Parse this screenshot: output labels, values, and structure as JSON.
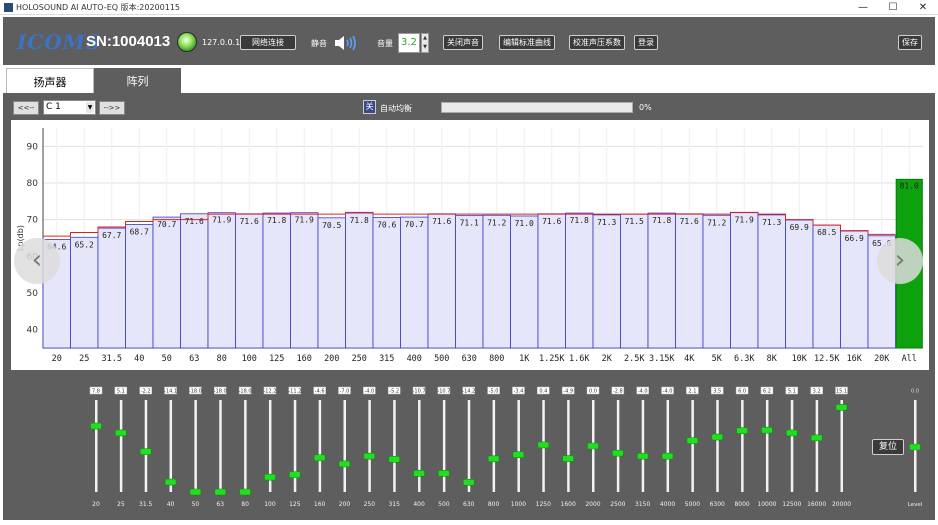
{
  "window": {
    "title": "HOLOSOUND AI AUTO-EQ  版本:20200115",
    "min": "—",
    "max": "☐",
    "close": "✕"
  },
  "toolbar": {
    "logo": "ICOMS",
    "serial": "SN:1004013",
    "ip": "127.0.0.1",
    "connect_label": "网络连接",
    "mute_label": "静音",
    "volume_label": "音量",
    "volume_value": "3.2",
    "close_sound_label": "关闭声音",
    "edit_curve_label": "编辑标准曲线",
    "calibrate_label": "校准声压系数",
    "login_label": "登录",
    "save_label": "保存"
  },
  "tabs": [
    "扬声器",
    "阵列"
  ],
  "nav": {
    "prev_label": "<<--",
    "next_label": "-->>",
    "channel": "C 1",
    "toggle_label": "关",
    "auto_label": "自动均衡",
    "progress": 0,
    "progress_text": "0%"
  },
  "chart_data": {
    "type": "bar",
    "ylabel": "Lp(db)",
    "ylim": [
      35,
      95
    ],
    "yticks": [
      40,
      50,
      60,
      70,
      80,
      90
    ],
    "grid": true,
    "categories": [
      "20",
      "25",
      "31.5",
      "40",
      "50",
      "63",
      "80",
      "100",
      "125",
      "160",
      "200",
      "250",
      "315",
      "400",
      "500",
      "630",
      "800",
      "1K",
      "1.25K",
      "1.6K",
      "2K",
      "2.5K",
      "3.15K",
      "4K",
      "5K",
      "6.3K",
      "8K",
      "10K",
      "12.5K",
      "16K",
      "20K",
      "All"
    ],
    "values": [
      64.6,
      65.2,
      67.7,
      68.7,
      70.7,
      71.6,
      71.9,
      71.6,
      71.8,
      71.9,
      70.5,
      71.8,
      70.6,
      70.7,
      71.6,
      71.1,
      71.2,
      71.0,
      71.6,
      71.8,
      71.3,
      71.5,
      71.8,
      71.6,
      71.2,
      71.9,
      71.3,
      69.9,
      68.5,
      66.9,
      65.6,
      81.0
    ],
    "value_labels": [
      "64.6",
      "65.2",
      "67.7",
      "68.7",
      "70.7",
      "71.6",
      "71.9",
      "71.6",
      "71.8",
      "71.9",
      "70.5",
      "71.8",
      "70.6",
      "70.7",
      "71.6",
      "71.1",
      "71.2",
      "71.0",
      "71.6",
      "71.8",
      "71.3",
      "71.5",
      "71.8",
      "71.6",
      "71.2",
      "71.9",
      "71.3",
      "69.9",
      "68.5",
      "66.9",
      "65.6",
      "81.0"
    ],
    "target": [
      65.5,
      66.5,
      68.0,
      69.5,
      70.0,
      70.0,
      71.5,
      71.5,
      71.5,
      71.5,
      71.5,
      72.0,
      71.5,
      71.5,
      71.5,
      71.5,
      71.5,
      71.5,
      71.5,
      71.5,
      71.5,
      71.5,
      71.5,
      71.5,
      71.5,
      72.0,
      71.5,
      70.0,
      68.5,
      67.0,
      66.0
    ],
    "bar_fill": "#e6e6fa",
    "bar_stroke": "#3838c8",
    "target_color": "#e02020",
    "all_fill": "#0ea10e"
  },
  "eq": {
    "bands": [
      "20",
      "25",
      "31.5",
      "40",
      "50",
      "63",
      "80",
      "100",
      "125",
      "160",
      "200",
      "250",
      "315",
      "400",
      "500",
      "630",
      "800",
      "1000",
      "1250",
      "1600",
      "2000",
      "2500",
      "3150",
      "4000",
      "5000",
      "6300",
      "8000",
      "10000",
      "12500",
      "16000",
      "20000"
    ],
    "gains": [
      "7.8",
      "5.1",
      "-2.2",
      "-14.1",
      "-18.0",
      "-18.0",
      "-18.0",
      "-12.2",
      "-11.2",
      "-4.6",
      "-7.0",
      "-4.0",
      "-5.2",
      "-10.7",
      "-10.7",
      "-14.2",
      "-5.0",
      "-3.4",
      "0.4",
      "-4.9",
      "0.0",
      "-2.8",
      "-4.0",
      "-4.0",
      "2.1",
      "3.5",
      "6.0",
      "6.2",
      "5.1",
      "3.2",
      "15.1"
    ],
    "gain_values": [
      7.8,
      5.1,
      -2.2,
      -14.1,
      -18.0,
      -18.0,
      -18.0,
      -12.2,
      -11.2,
      -4.6,
      -7.0,
      -4.0,
      -5.2,
      -10.7,
      -10.7,
      -14.2,
      -5.0,
      -3.4,
      0.4,
      -4.9,
      0.0,
      -2.8,
      -4.0,
      -4.0,
      2.1,
      3.5,
      6.0,
      6.2,
      5.1,
      3.2,
      15.1
    ],
    "range": [
      -18,
      18
    ],
    "level_label": "Level",
    "level_value": "0.0",
    "level_gain": 0.0,
    "reset_label": "复位",
    "thumb_color": "#22dd22"
  }
}
